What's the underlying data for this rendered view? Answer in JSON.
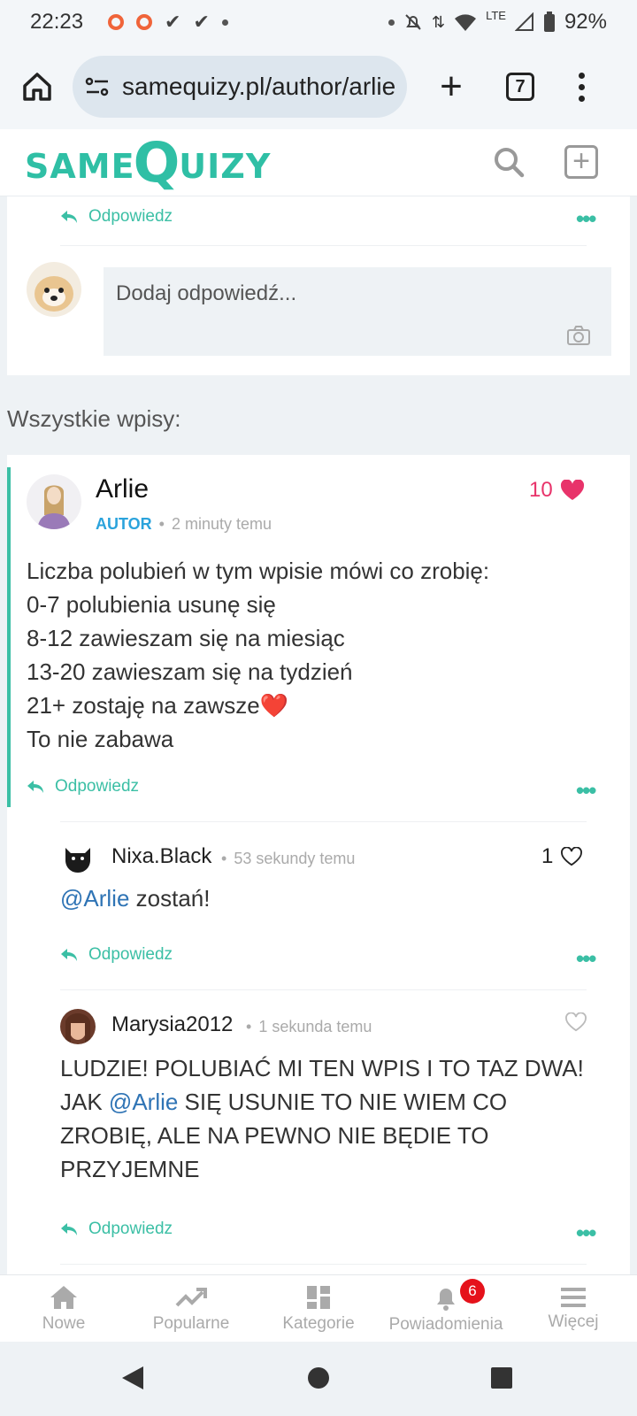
{
  "status_bar": {
    "time": "22:23",
    "lte": "LTE",
    "battery": "92%"
  },
  "browser": {
    "url": "samequizy.pl/author/arlie",
    "tab_count": "7"
  },
  "site": {
    "logo_small_1": "SAME",
    "logo_big": "Q",
    "logo_small_2": "UIZY"
  },
  "top_card": {
    "reply_label": "Odpowiedz",
    "reply_placeholder": "Dodaj odpowiedź..."
  },
  "section_title": "Wszystkie wpisy:",
  "post": {
    "author": "Arlie",
    "badge": "AUTOR",
    "time": "2 minuty temu",
    "likes": "10",
    "lines": [
      "Liczba polubień w tym wpisie mówi co zrobię:",
      "0-7 polubienia usunę się",
      "8-12 zawieszam się na miesiąc",
      "13-20 zawieszam się na tydzień",
      "21+ zostaję na zawsze❤️",
      "To nie zabawa"
    ],
    "reply_label": "Odpowiedz"
  },
  "comments": [
    {
      "author": "Nixa.Black",
      "time": "53 sekundy temu",
      "likes": "1",
      "mention": "@Arlie",
      "text": " zostań!",
      "reply_label": "Odpowiedz"
    },
    {
      "author": "Marysia2012",
      "time": "1 sekunda temu",
      "likes": "",
      "line1": "LUDZIE! POLUBIAĆ MI TEN WPIS I TO TAZ DWA!",
      "line2_pre": "JAK ",
      "mention": "@Arlie",
      "line2_post": " SIĘ USUNIE TO NIE WIEM CO",
      "line3": "ZROBIĘ, ALE NA PEWNO NIE BĘDIE TO",
      "line4": "PRZYJEMNE",
      "reply_label": "Odpowiedz"
    }
  ],
  "bottom_nav": {
    "items": [
      "Nowe",
      "Popularne",
      "Kategorie",
      "Powiadomienia",
      "Więcej"
    ],
    "notification_count": "6"
  },
  "colors": {
    "accent": "#3bbfa5",
    "heart": "#e8336a",
    "author_badge": "#2ba3dc",
    "mention": "#2f74b5"
  }
}
